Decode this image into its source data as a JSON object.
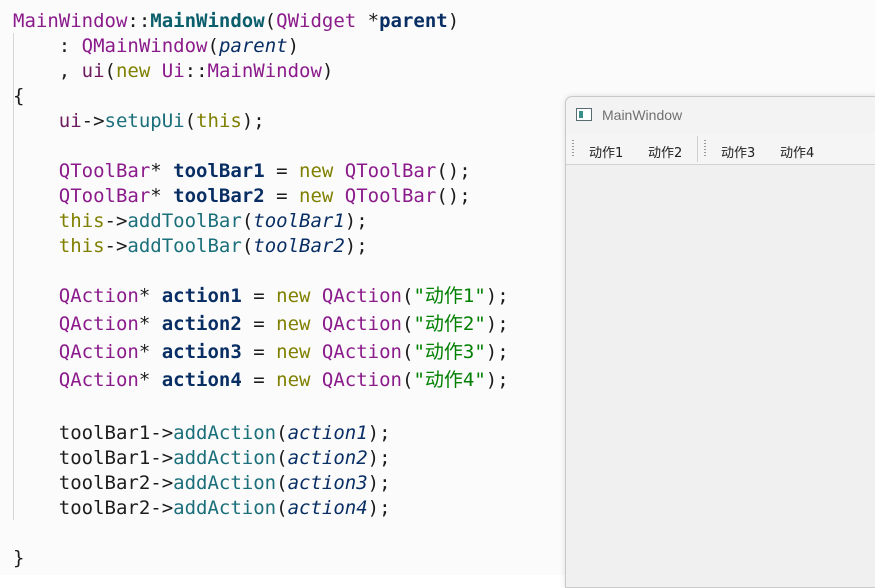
{
  "code": {
    "lines": [
      [
        [
          "t-class",
          "MainWindow"
        ],
        [
          "t-plain",
          "::"
        ],
        [
          "t-funcb",
          "MainWindow"
        ],
        [
          "t-plain",
          "("
        ],
        [
          "t-class",
          "QWidget"
        ],
        [
          "t-plain",
          " *"
        ],
        [
          "t-var",
          "parent"
        ],
        [
          "t-plain",
          ")"
        ]
      ],
      [
        [
          "t-plain",
          "    : "
        ],
        [
          "t-class",
          "QMainWindow"
        ],
        [
          "t-plain",
          "("
        ],
        [
          "t-param",
          "parent"
        ],
        [
          "t-plain",
          ")"
        ]
      ],
      [
        [
          "t-plain",
          "    , "
        ],
        [
          "t-member",
          "ui"
        ],
        [
          "t-plain",
          "("
        ],
        [
          "t-kw",
          "new"
        ],
        [
          "t-plain",
          " "
        ],
        [
          "t-class",
          "Ui"
        ],
        [
          "t-plain",
          "::"
        ],
        [
          "t-class",
          "MainWindow"
        ],
        [
          "t-plain",
          ")"
        ]
      ],
      [
        [
          "t-plain",
          "{"
        ]
      ],
      [
        [
          "t-plain",
          "    "
        ],
        [
          "t-member",
          "ui"
        ],
        [
          "t-plain",
          "->"
        ],
        [
          "t-func",
          "setupUi"
        ],
        [
          "t-plain",
          "("
        ],
        [
          "t-kw",
          "this"
        ],
        [
          "t-plain",
          ");"
        ]
      ],
      [
        [
          "t-plain",
          "    "
        ],
        [
          "t-class",
          "QToolBar"
        ],
        [
          "t-plain",
          "* "
        ],
        [
          "t-var",
          "toolBar1"
        ],
        [
          "t-plain",
          " = "
        ],
        [
          "t-kw",
          "new"
        ],
        [
          "t-plain",
          " "
        ],
        [
          "t-class",
          "QToolBar"
        ],
        [
          "t-plain",
          "();"
        ]
      ],
      [
        [
          "t-plain",
          "    "
        ],
        [
          "t-class",
          "QToolBar"
        ],
        [
          "t-plain",
          "* "
        ],
        [
          "t-var",
          "toolBar2"
        ],
        [
          "t-plain",
          " = "
        ],
        [
          "t-kw",
          "new"
        ],
        [
          "t-plain",
          " "
        ],
        [
          "t-class",
          "QToolBar"
        ],
        [
          "t-plain",
          "();"
        ]
      ],
      [
        [
          "t-plain",
          "    "
        ],
        [
          "t-kw",
          "this"
        ],
        [
          "t-plain",
          "->"
        ],
        [
          "t-func",
          "addToolBar"
        ],
        [
          "t-plain",
          "("
        ],
        [
          "t-param",
          "toolBar1"
        ],
        [
          "t-plain",
          ");"
        ]
      ],
      [
        [
          "t-plain",
          "    "
        ],
        [
          "t-kw",
          "this"
        ],
        [
          "t-plain",
          "->"
        ],
        [
          "t-func",
          "addToolBar"
        ],
        [
          "t-plain",
          "("
        ],
        [
          "t-param",
          "toolBar2"
        ],
        [
          "t-plain",
          ");"
        ]
      ],
      [
        [
          "t-plain",
          "    "
        ],
        [
          "t-class",
          "QAction"
        ],
        [
          "t-plain",
          "* "
        ],
        [
          "t-var",
          "action1"
        ],
        [
          "t-plain",
          " = "
        ],
        [
          "t-kw",
          "new"
        ],
        [
          "t-plain",
          " "
        ],
        [
          "t-class",
          "QAction"
        ],
        [
          "t-plain",
          "("
        ],
        [
          "t-str",
          "\"动作1\""
        ],
        [
          "t-plain",
          ");"
        ]
      ],
      [
        [
          "t-plain",
          "    "
        ],
        [
          "t-class",
          "QAction"
        ],
        [
          "t-plain",
          "* "
        ],
        [
          "t-var",
          "action2"
        ],
        [
          "t-plain",
          " = "
        ],
        [
          "t-kw",
          "new"
        ],
        [
          "t-plain",
          " "
        ],
        [
          "t-class",
          "QAction"
        ],
        [
          "t-plain",
          "("
        ],
        [
          "t-str",
          "\"动作2\""
        ],
        [
          "t-plain",
          ");"
        ]
      ],
      [
        [
          "t-plain",
          "    "
        ],
        [
          "t-class",
          "QAction"
        ],
        [
          "t-plain",
          "* "
        ],
        [
          "t-var",
          "action3"
        ],
        [
          "t-plain",
          " = "
        ],
        [
          "t-kw",
          "new"
        ],
        [
          "t-plain",
          " "
        ],
        [
          "t-class",
          "QAction"
        ],
        [
          "t-plain",
          "("
        ],
        [
          "t-str",
          "\"动作3\""
        ],
        [
          "t-plain",
          ");"
        ]
      ],
      [
        [
          "t-plain",
          "    "
        ],
        [
          "t-class",
          "QAction"
        ],
        [
          "t-plain",
          "* "
        ],
        [
          "t-var",
          "action4"
        ],
        [
          "t-plain",
          " = "
        ],
        [
          "t-kw",
          "new"
        ],
        [
          "t-plain",
          " "
        ],
        [
          "t-class",
          "QAction"
        ],
        [
          "t-plain",
          "("
        ],
        [
          "t-str",
          "\"动作4\""
        ],
        [
          "t-plain",
          ");"
        ]
      ],
      [
        [
          "t-plain",
          "    "
        ],
        [
          "t-plain",
          "toolBar1->"
        ],
        [
          "t-func",
          "addAction"
        ],
        [
          "t-plain",
          "("
        ],
        [
          "t-param",
          "action1"
        ],
        [
          "t-plain",
          ");"
        ]
      ],
      [
        [
          "t-plain",
          "    "
        ],
        [
          "t-plain",
          "toolBar1->"
        ],
        [
          "t-func",
          "addAction"
        ],
        [
          "t-plain",
          "("
        ],
        [
          "t-param",
          "action2"
        ],
        [
          "t-plain",
          ");"
        ]
      ],
      [
        [
          "t-plain",
          "    "
        ],
        [
          "t-plain",
          "toolBar2->"
        ],
        [
          "t-func",
          "addAction"
        ],
        [
          "t-plain",
          "("
        ],
        [
          "t-param",
          "action3"
        ],
        [
          "t-plain",
          ");"
        ]
      ],
      [
        [
          "t-plain",
          "    "
        ],
        [
          "t-plain",
          "toolBar2->"
        ],
        [
          "t-func",
          "addAction"
        ],
        [
          "t-plain",
          "("
        ],
        [
          "t-param",
          "action4"
        ],
        [
          "t-plain",
          ");"
        ]
      ],
      [
        [
          "t-plain",
          "}"
        ]
      ]
    ]
  },
  "window": {
    "title": "MainWindow",
    "icon": "qt-window-icon",
    "toolbar1": [
      "动作1",
      "动作2"
    ],
    "toolbar2": [
      "动作3",
      "动作4"
    ]
  }
}
